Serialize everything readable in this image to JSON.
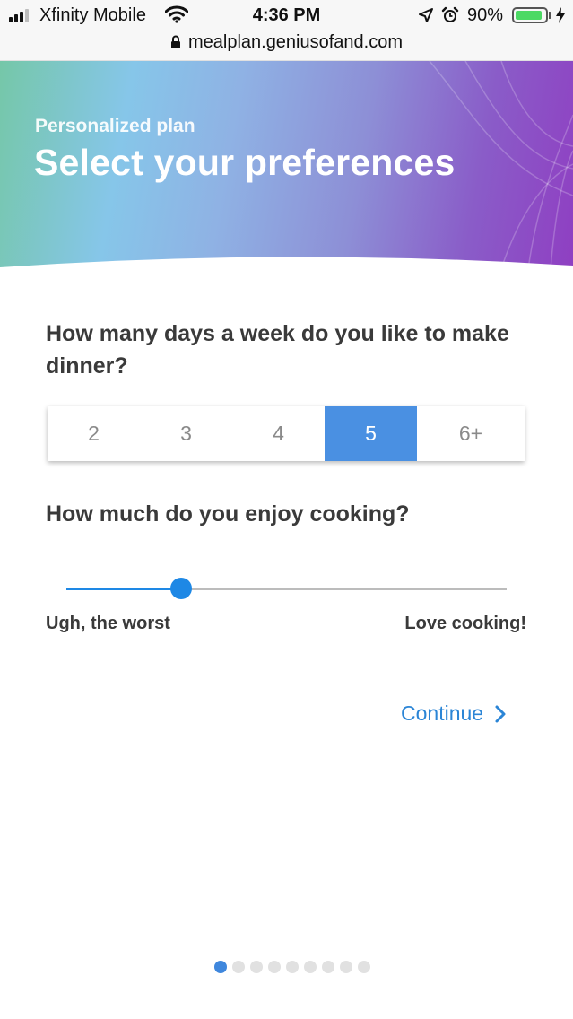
{
  "status_bar": {
    "carrier": "Xfinity Mobile",
    "time": "4:36 PM",
    "battery_percent": "90%",
    "battery_level": 0.9,
    "icons": [
      "signal-icon",
      "wifi-icon",
      "location-arrow-icon",
      "alarm-icon",
      "battery-icon",
      "charging-bolt-icon"
    ]
  },
  "browser": {
    "url": "mealplan.geniusofand.com",
    "lock_icon": "lock-icon"
  },
  "hero": {
    "subtitle": "Personalized plan",
    "title": "Select your preferences",
    "gradient_colors": [
      "#75c7a8",
      "#86c6e9",
      "#8d8fd6",
      "#8f3fc2"
    ]
  },
  "questions": {
    "days": {
      "label": "How many days a week do you like to make dinner?",
      "options": [
        "2",
        "3",
        "4",
        "5",
        "6+"
      ],
      "selected": "5"
    },
    "enjoy": {
      "label": "How much do you enjoy cooking?",
      "min_label": "Ugh, the worst",
      "max_label": "Love cooking!",
      "value": 0.26
    }
  },
  "continue": {
    "label": "Continue",
    "icon": "chevron-right-icon"
  },
  "pager": {
    "total": 9,
    "current": 1
  },
  "colors": {
    "accent": "#4a90e2",
    "slider": "#1e88e5",
    "link": "#2b85d6"
  }
}
